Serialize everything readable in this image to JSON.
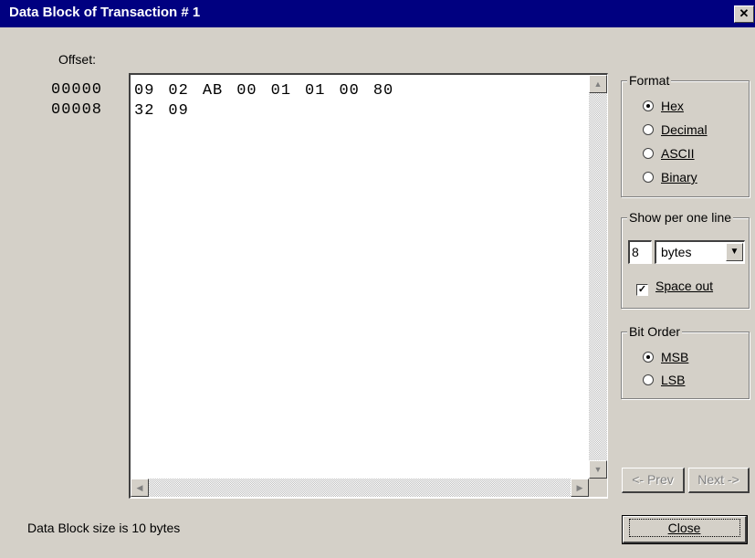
{
  "window": {
    "title": "Data Block of Transaction # 1",
    "close_glyph": "✕"
  },
  "offset_label": "Offset:",
  "offsets": [
    "00000",
    "00008"
  ],
  "hex_lines": [
    [
      "09",
      "02",
      "AB",
      "00",
      "01",
      "01",
      "00",
      "80"
    ],
    [
      "32",
      "09"
    ]
  ],
  "scroll_glyphs": {
    "up": "▲",
    "down": "▼",
    "left": "◀",
    "right": "▶"
  },
  "format": {
    "title": "Format",
    "options": [
      {
        "label": "Hex",
        "selected": true
      },
      {
        "label": "Decimal",
        "selected": false
      },
      {
        "label": "ASCII",
        "selected": false
      },
      {
        "label": "Binary",
        "selected": false
      }
    ]
  },
  "show_per_line": {
    "title": "Show per one line",
    "count": "8",
    "unit": "bytes",
    "dropdown_glyph": "▼",
    "space_out_label": "Space out",
    "space_out_checked": true,
    "check_glyph": "✓"
  },
  "bit_order": {
    "title": "Bit Order",
    "options": [
      {
        "label": "MSB",
        "selected": true
      },
      {
        "label": "LSB",
        "selected": false
      }
    ]
  },
  "buttons": {
    "prev": "<- Prev",
    "next": "Next ->",
    "close": "Close"
  },
  "status": "Data Block size is 10 bytes"
}
